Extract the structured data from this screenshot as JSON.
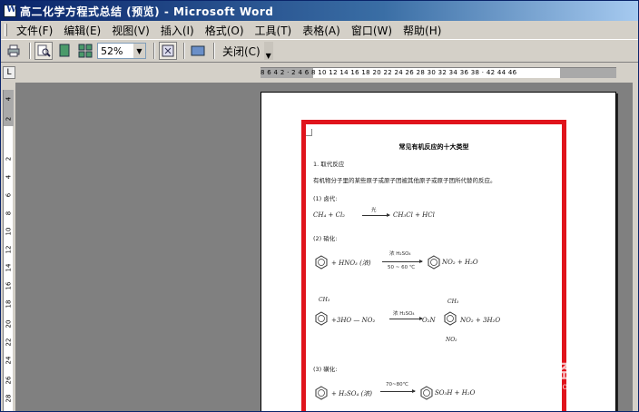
{
  "window": {
    "title": "高二化学方程式总结 (预览) - Microsoft Word"
  },
  "menubar": {
    "items": [
      {
        "label": "文件(F)"
      },
      {
        "label": "编辑(E)"
      },
      {
        "label": "视图(V)"
      },
      {
        "label": "插入(I)"
      },
      {
        "label": "格式(O)"
      },
      {
        "label": "工具(T)"
      },
      {
        "label": "表格(A)"
      },
      {
        "label": "窗口(W)"
      },
      {
        "label": "帮助(H)"
      }
    ]
  },
  "toolbar": {
    "zoom_value": "52%",
    "close_label": "关闭(C)",
    "buttons": [
      "print-icon",
      "magnifier-icon",
      "one-page-icon",
      "multiple-pages-icon",
      "shrink-to-fit-icon",
      "full-screen-icon"
    ]
  },
  "ruler": {
    "horizontal_ticks": "8 6 4 2 · 2 4 6 8 10 12 14 16 18 20 22 24 26 28 30 32 34 36 38 · 42 44 46",
    "vertical_ticks": [
      "4",
      "2",
      "2",
      "4",
      "6",
      "8",
      "10",
      "12",
      "14",
      "16",
      "18",
      "20",
      "22",
      "24",
      "26",
      "28"
    ]
  },
  "document": {
    "title": "常见有机反应的十大类型",
    "section1": "1. 取代反应",
    "definition": "有机物分子里的某些原子或原子团被其他原子或原子团所代替的反应。",
    "sub1": "(1) 卤代:",
    "eq1_left": "CH₄ + Cl₂",
    "eq1_cond": "光",
    "eq1_right": "CH₃Cl + HCl",
    "sub2": "(2) 硝化:",
    "eq2_left": "+ HNO₃ (浓)",
    "eq2_cond_top": "浓 H₂SO₄",
    "eq2_cond_bottom": "50 ~ 60 ℃",
    "eq2_right": "NO₂ + H₂O",
    "eq3_methyl": "CH₃",
    "eq3_left": "+3HO — NO₂",
    "eq3_cond": "浓 H₂SO₄",
    "eq3_right_left": "O₂N",
    "eq3_right_right": "NO₂ + 3H₂O",
    "eq3_top": "CH₃",
    "eq3_bottom": "NO₂",
    "sub3": "(3) 磺化:",
    "eq4_left": "+ H₂SO₄ (浓)",
    "eq4_cond": "70~80℃",
    "eq4_right": "SO₃H + H₂O"
  },
  "watermark": {
    "main": "Baidu 经验",
    "sub": "jingyan.baidu.com"
  },
  "colors": {
    "titlebar": "#0a246a",
    "chrome": "#d4d0c8",
    "workspace": "#808080",
    "highlight_box": "#e0141c"
  }
}
